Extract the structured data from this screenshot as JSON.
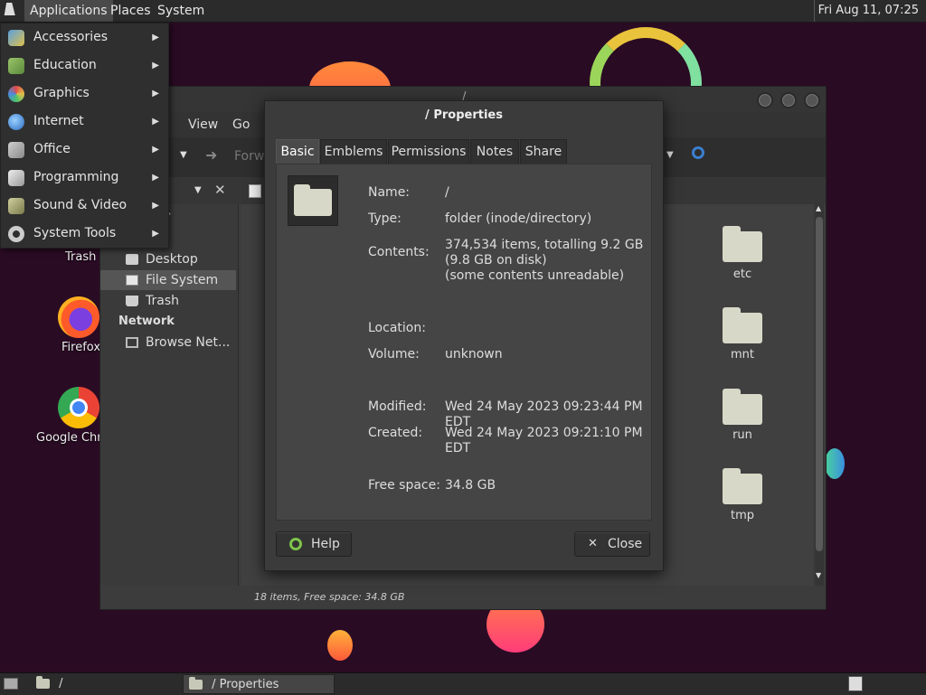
{
  "top_panel": {
    "menus": [
      "Applications",
      "Places",
      "System"
    ],
    "clock": "Fri Aug 11, 07:25"
  },
  "app_menu": {
    "items": [
      {
        "label": "Accessories",
        "icon": "accessories-icon"
      },
      {
        "label": "Education",
        "icon": "education-icon"
      },
      {
        "label": "Graphics",
        "icon": "graphics-icon"
      },
      {
        "label": "Internet",
        "icon": "internet-icon"
      },
      {
        "label": "Office",
        "icon": "office-icon"
      },
      {
        "label": "Programming",
        "icon": "programming-icon"
      },
      {
        "label": "Sound & Video",
        "icon": "sound-video-icon"
      },
      {
        "label": "System Tools",
        "icon": "system-tools-icon"
      }
    ]
  },
  "desktop": {
    "icons": [
      {
        "label": "Trash"
      },
      {
        "label": "Firefox"
      },
      {
        "label": "Google Chr"
      }
    ]
  },
  "file_manager": {
    "title": "/",
    "menus": [
      "t",
      "View",
      "Go"
    ],
    "toolbar": {
      "forward_label": "Forw"
    },
    "sidebar": {
      "partial_items": [
        "er",
        "3"
      ],
      "items": [
        "Desktop",
        "File System",
        "Trash"
      ],
      "network_heading": "Network",
      "network_items": [
        "Browse Net..."
      ]
    },
    "folders": [
      "etc",
      "mnt",
      "run",
      "tmp"
    ],
    "status": "18 items, Free space: 34.8 GB"
  },
  "properties_dialog": {
    "title": "/ Properties",
    "tabs": [
      "Basic",
      "Emblems",
      "Permissions",
      "Notes",
      "Share"
    ],
    "active_tab": "Basic",
    "fields": {
      "name_label": "Name:",
      "name_value": "/",
      "type_label": "Type:",
      "type_value": "folder (inode/directory)",
      "contents_label": "Contents:",
      "contents_line1": "374,534 items, totalling 9.2 GB",
      "contents_line2": "(9.8 GB on disk)",
      "contents_line3": "(some contents unreadable)",
      "location_label": "Location:",
      "volume_label": "Volume:",
      "volume_value": "unknown",
      "modified_label": "Modified:",
      "modified_value": "Wed 24 May 2023 09:23:44 PM EDT",
      "created_label": "Created:",
      "created_value": "Wed 24 May 2023 09:21:10 PM EDT",
      "free_label": "Free space:",
      "free_value": "34.8 GB"
    },
    "help_label": "Help",
    "close_label": "Close"
  },
  "taskbar": {
    "items": [
      "/",
      "/ Properties"
    ]
  }
}
